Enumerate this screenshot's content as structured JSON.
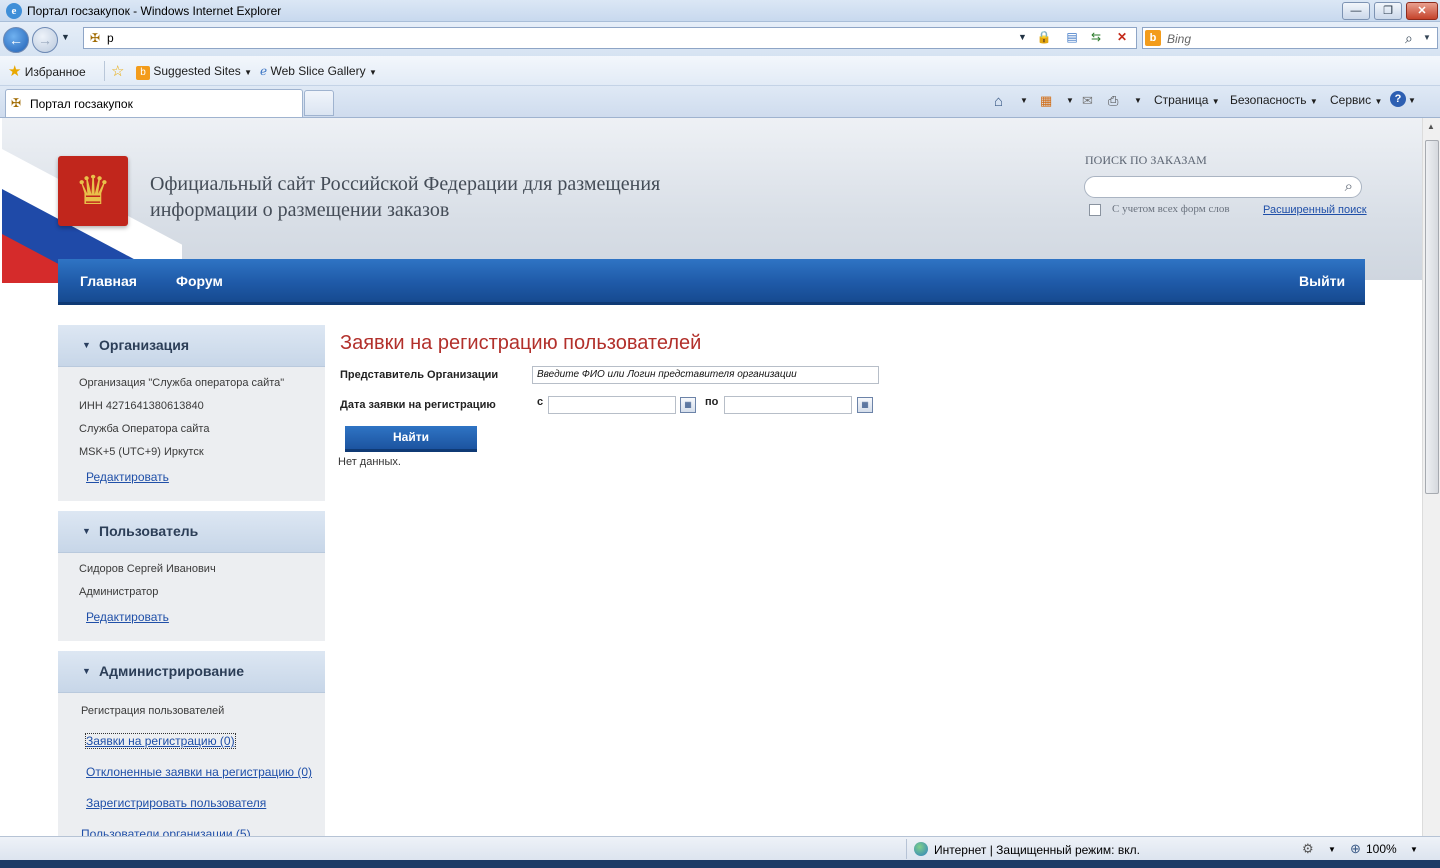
{
  "window": {
    "title": "Портал госзакупок - Windows Internet Explorer",
    "minimize": "—",
    "maximize": "❐",
    "close": "✕"
  },
  "address": {
    "url": "p",
    "search_engine": "Bing",
    "search_placeholder": "Bing"
  },
  "favorites": {
    "label": "Избранное",
    "suggested": "Suggested Sites",
    "webslice": "Web Slice Gallery"
  },
  "tab": {
    "title": "Портал госзакупок"
  },
  "commands": {
    "page": "Страница",
    "safety": "Безопасность",
    "service": "Сервис"
  },
  "site": {
    "title_line1": "Официальный сайт Российской Федерации для размещения",
    "title_line2": "информации о размещении заказов",
    "search_label": "ПОИСК ПО ЗАКАЗАМ",
    "search_checkbox_label": "С учетом всех форм слов",
    "advanced_search": "Расширенный поиск"
  },
  "menu": {
    "home": "Главная",
    "forum": "Форум",
    "logout": "Выйти"
  },
  "org_panel": {
    "title": "Организация",
    "lines": [
      "Организация \"Служба оператора сайта\"",
      "ИНН 4271641380613840",
      "Служба Оператора сайта",
      "MSK+5 (UTC+9) Иркутск"
    ],
    "edit": "Редактировать"
  },
  "user_panel": {
    "title": "Пользователь",
    "lines": [
      "Сидоров Сергей Иванович",
      "Администратор"
    ],
    "edit": "Редактировать"
  },
  "admin_panel": {
    "title": "Администрирование",
    "section": "Регистрация пользователей",
    "links": [
      "Заявки на регистрацию (0)",
      "Отклоненные заявки на регистрацию (0)",
      "Зарегистрировать пользователя",
      "Пользователи организации (5)"
    ]
  },
  "content": {
    "title": "Заявки на регистрацию пользователей",
    "rep_label": "Представитель Организации",
    "rep_placeholder": "Введите ФИО или Логин представителя организации",
    "date_label": "Дата заявки на регистрацию",
    "from_label": "с",
    "to_label": "по",
    "find_button": "Найти",
    "no_data": "Нет данных."
  },
  "status": {
    "zone": "Интернет | Защищенный режим: вкл.",
    "zoom": "100%"
  }
}
